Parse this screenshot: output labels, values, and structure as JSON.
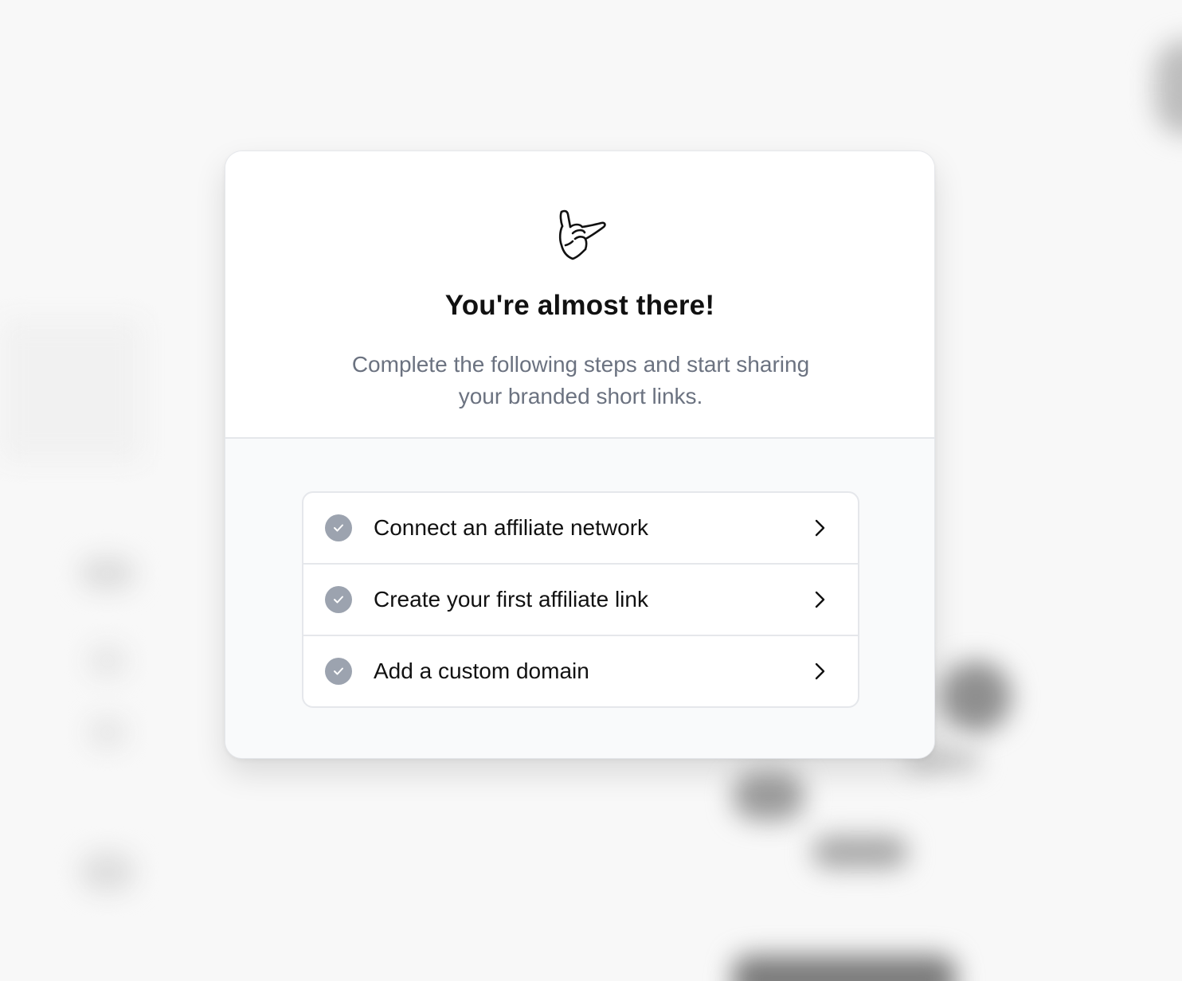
{
  "modal": {
    "title": "You're almost there!",
    "subtitle": "Complete the following steps and start sharing your branded short links.",
    "icon": "call-me-hand-icon"
  },
  "steps": [
    {
      "label": "Connect an affiliate network",
      "icon": "check-circle-icon",
      "status": "incomplete"
    },
    {
      "label": "Create your first affiliate link",
      "icon": "check-circle-icon",
      "status": "incomplete"
    },
    {
      "label": "Add a custom domain",
      "icon": "check-circle-icon",
      "status": "incomplete"
    }
  ],
  "colors": {
    "check_bg": "#9ca3af",
    "subtitle": "#6b7280",
    "border": "#e5e7eb",
    "body_bg": "#f9fafb"
  }
}
